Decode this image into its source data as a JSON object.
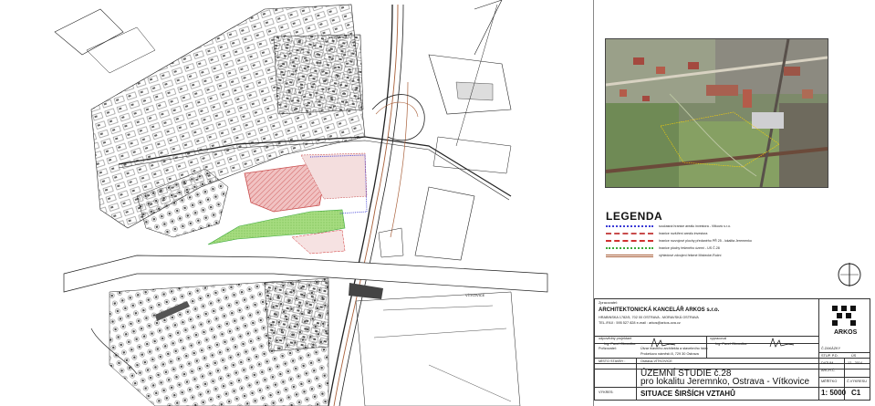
{
  "colors": {
    "study_boundary": "#3b3bd6",
    "built_area": "#e6a2a2",
    "built_area_hatch": "#c84b4b",
    "greenery": "#8fd26a",
    "railway": "#a9603a",
    "map_line": "#222222"
  },
  "plan": {
    "labels": [
      "VÍTKOVICE",
      "VÍTKOVICE"
    ]
  },
  "legend": {
    "title": "LEGENDA",
    "items": [
      {
        "label": "současná hranice areálu investora - Vitkovic s.r.o.",
        "color": "#3b3bd6",
        "style": "dotted"
      },
      {
        "label": "hranice rozšíření areálu investora",
        "color": "#c84b4b",
        "style": "dashdot"
      },
      {
        "label": "hranice rozvojové plochy předaného PŘ 25 - lokalita Jeremenko",
        "color": "#d03030",
        "style": "dashed"
      },
      {
        "label": "hranice plochy řešeného území - US Č.28",
        "color": "#3aa83a",
        "style": "dotted"
      },
      {
        "label": "výhledové zdvojení řešené Místecké-Ruční",
        "color": "#a9603a",
        "style": "double"
      }
    ]
  },
  "north_arrow_icon": "north-arrow-icon",
  "title_block": {
    "zpracovatel_label": "Zpracovatel:",
    "firm": "ARCHITEKTONICKÁ KANCELÁŘ ARKOS s.r.o.",
    "address": "HRABINSKA 1782/5, 702 00 OSTRAVA - MORAVSKÁ OSTRAVA",
    "contact": "TEL./FAX : 595 527 828     e-mail : arkos@arkos-ova.cz",
    "role1_label": "odpovědný projektant",
    "role1_name": "Ing. Pavel Obroučka",
    "role2_label": "vypracoval",
    "role2_name": "Ing. Pavel Obroučka",
    "client_label": "Pořizovatel:",
    "client_line1": "Útvar hlavního architekta a stavebního řádu",
    "client_line2": "Prokešovo náměstí 8, 729 30 Ostrava",
    "place_label": "MÍSTO STAVBY :",
    "place_value": "Ostrava-VÍTKOVICE",
    "study_line1": "ÚZEMNÍ STUDIE č.28",
    "study_line2": "pro lokalitu Jeremnko, Ostrava - Vítkovice",
    "drawing_label": "VÝKRES:",
    "drawing_title": "SITUACE ŠIRŠÍCH VZTAHŮ",
    "logo_text": "ARKOS",
    "zakazka_label": "Č.ZAKÁZKY",
    "stupen_label": "STUP. P.D.",
    "stupen_value": "ÚS",
    "datum_label": "DATUM",
    "datum_value": "12 - 2014",
    "arch_label": "ARCH.Č.",
    "arch_value": "",
    "meritko_label": "MĚŘÍTKO",
    "meritko_value": "1: 5000",
    "cislo_label": "Č.VÝKRESU",
    "cislo_value": "C1"
  }
}
